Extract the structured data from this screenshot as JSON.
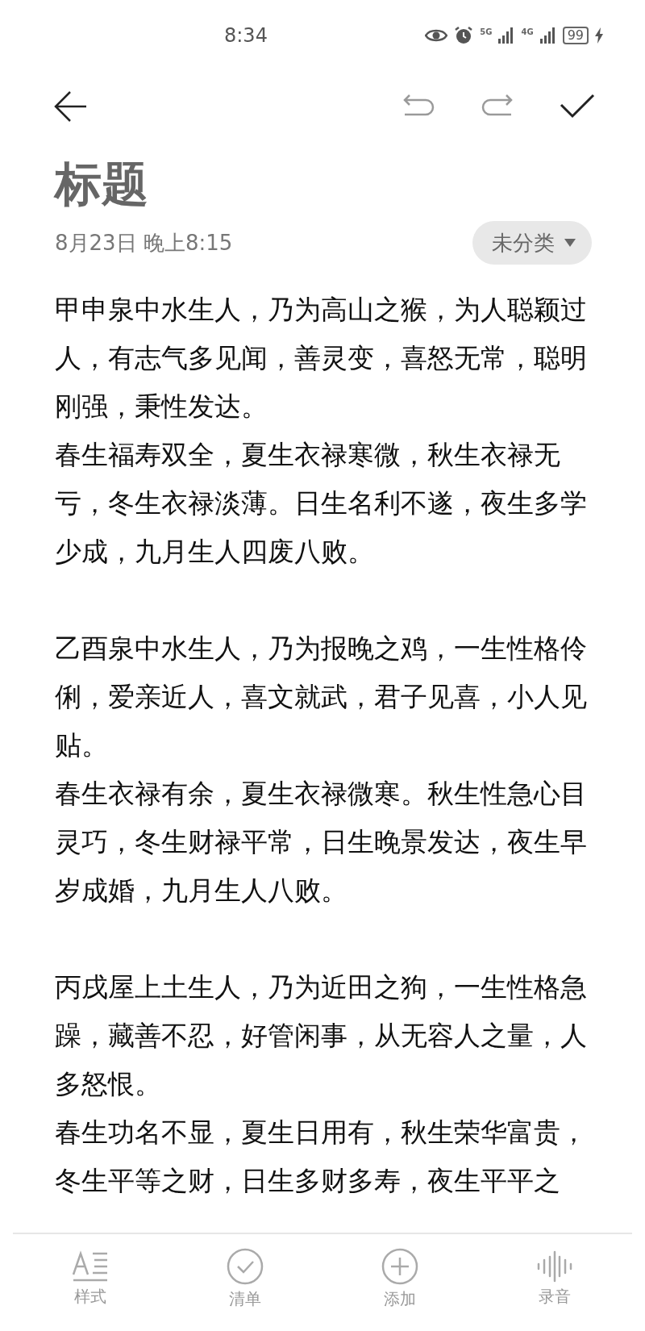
{
  "status_bar": {
    "time": "8:34",
    "network_1": "5G",
    "network_2": "4G",
    "battery": "99"
  },
  "toolbar": {
    "undo_disabled": true,
    "redo_disabled": true
  },
  "note": {
    "title": "标题",
    "date": "8月23日 晚上8:15",
    "category": "未分类",
    "sections": [
      {
        "paragraphs": [
          "甲申泉中水生人，乃为高山之猴，为人聪颖过人，有志气多见闻，善灵变，喜怒无常，聪明刚强，秉性发达。",
          "春生福寿双全，夏生衣禄寒微，秋生衣禄无亏，冬生衣禄淡薄。日生名利不遂，夜生多学少成，九月生人四废八败。"
        ]
      },
      {
        "paragraphs": [
          "乙酉泉中水生人，乃为报晚之鸡，一生性格伶俐，爱亲近人，喜文就武，君子见喜，小人见贴。",
          "春生衣禄有余，夏生衣禄微寒。秋生性急心目灵巧，冬生财禄平常，日生晚景发达，夜生早岁成婚，九月生人八败。"
        ]
      },
      {
        "paragraphs": [
          "丙戌屋上土生人，乃为近田之狗，一生性格急躁，藏善不忍，好管闲事，从无容人之量，人多怒恨。",
          "春生功名不显，夏生日用有，秋生荣华富贵，冬生平等之财，日生多财多寿，夜生平平之"
        ]
      }
    ]
  },
  "bottom_bar": [
    {
      "kind": "style",
      "label": "样式"
    },
    {
      "kind": "checklist",
      "label": "清单"
    },
    {
      "kind": "add",
      "label": "添加"
    },
    {
      "kind": "record",
      "label": "录音"
    }
  ]
}
